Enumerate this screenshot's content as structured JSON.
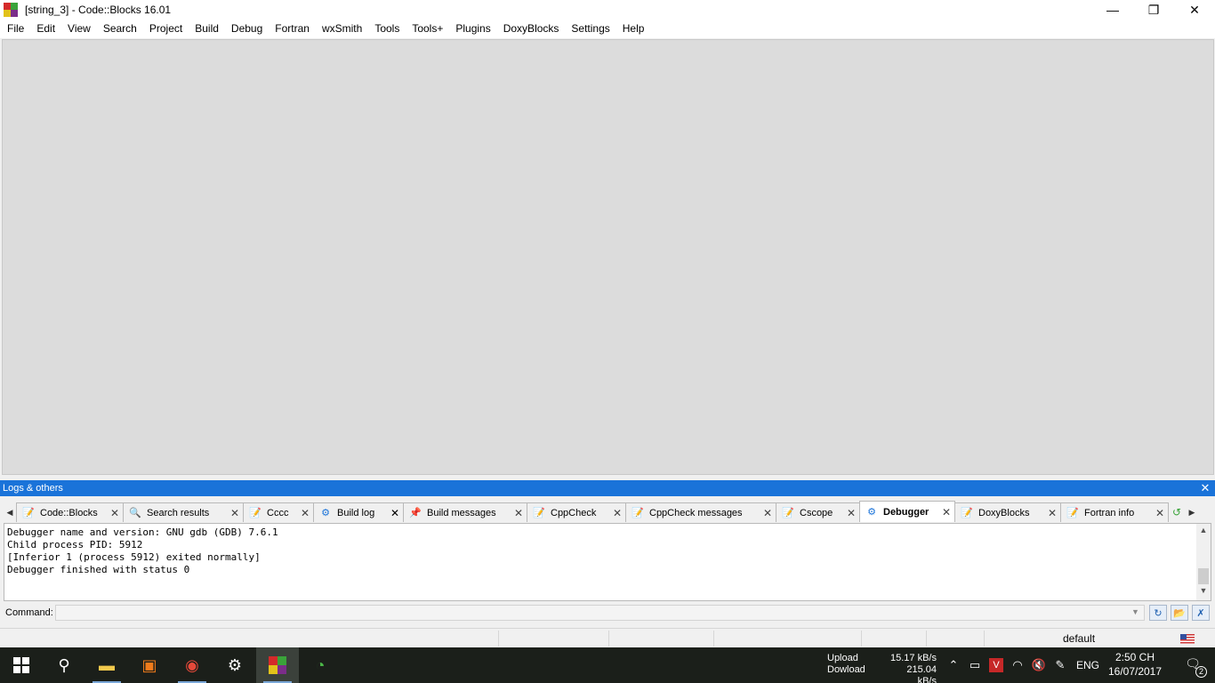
{
  "window": {
    "title": "[string_3] - Code::Blocks 16.01",
    "controls": {
      "minimize": "—",
      "restore": "❐",
      "close": "✕"
    }
  },
  "menu": {
    "items": [
      "File",
      "Edit",
      "View",
      "Search",
      "Project",
      "Build",
      "Debug",
      "Fortran",
      "wxSmith",
      "Tools",
      "Tools+",
      "Plugins",
      "DoxyBlocks",
      "Settings",
      "Help"
    ]
  },
  "logs_panel": {
    "title": "Logs & others",
    "close": "✕",
    "tabs": [
      {
        "label": "Code::Blocks",
        "icon": "page-edit-icon"
      },
      {
        "label": "Search results",
        "icon": "magnifier-icon"
      },
      {
        "label": "Cccc",
        "icon": "page-edit-icon"
      },
      {
        "label": "Build log",
        "icon": "gear-icon"
      },
      {
        "label": "Build messages",
        "icon": "pushpin-icon"
      },
      {
        "label": "CppCheck",
        "icon": "page-edit-icon"
      },
      {
        "label": "CppCheck messages",
        "icon": "page-edit-icon"
      },
      {
        "label": "Cscope",
        "icon": "page-edit-icon"
      },
      {
        "label": "Debugger",
        "icon": "gear-icon",
        "active": true
      },
      {
        "label": "DoxyBlocks",
        "icon": "page-edit-icon"
      },
      {
        "label": "Fortran info",
        "icon": "page-edit-icon"
      }
    ],
    "log_lines": [
      "Debugger name and version: GNU gdb (GDB) 7.6.1",
      "Child process PID: 5912",
      "[Inferior 1 (process 5912) exited normally]",
      "Debugger finished with status 0"
    ],
    "command_label": "Command:",
    "command_value": ""
  },
  "statusbar": {
    "mode": "default"
  },
  "taskbar": {
    "net": {
      "upload_label": "Upload",
      "download_label": "Dowload",
      "upload_speed": "15.17 kB/s",
      "download_speed": "215.04 kB/s"
    },
    "language": "ENG",
    "time": "2:50 CH",
    "date": "16/07/2017",
    "notification_count": "2"
  },
  "colors": {
    "logs_header": "#1a73d9",
    "editor_bg": "#dcdcdc",
    "taskbar_bg": "#1b1f1a"
  }
}
